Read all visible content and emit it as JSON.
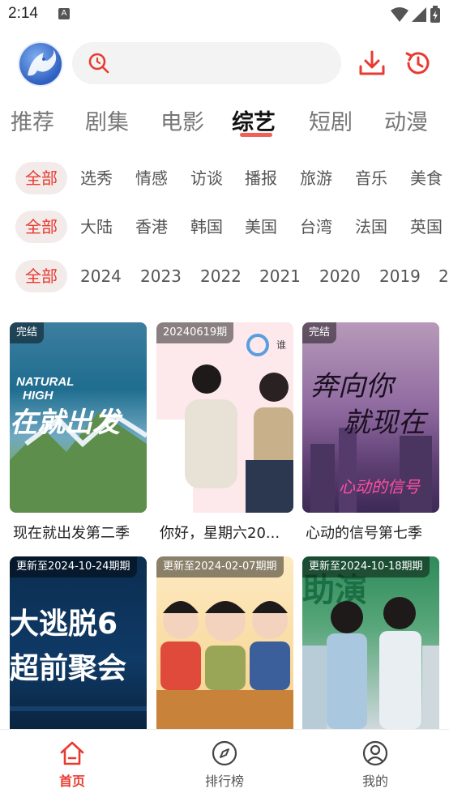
{
  "status": {
    "time": "2:14",
    "badge": "A"
  },
  "search": {
    "placeholder": ""
  },
  "category_tabs": [
    {
      "label": "推荐",
      "active": false
    },
    {
      "label": "剧集",
      "active": false
    },
    {
      "label": "电影",
      "active": false
    },
    {
      "label": "综艺",
      "active": true
    },
    {
      "label": "短剧",
      "active": false
    },
    {
      "label": "动漫",
      "active": false
    }
  ],
  "filters": {
    "type": [
      "全部",
      "选秀",
      "情感",
      "访谈",
      "播报",
      "旅游",
      "音乐",
      "美食"
    ],
    "region": [
      "全部",
      "大陆",
      "香港",
      "韩国",
      "美国",
      "台湾",
      "法国",
      "英国"
    ],
    "year": [
      "全部",
      "2024",
      "2023",
      "2022",
      "2021",
      "2020",
      "2019",
      "2"
    ]
  },
  "cards": [
    {
      "badge": "完结",
      "title": "现在就出发第二季",
      "poster_text": "NATURAL HIGH · 在就出发"
    },
    {
      "badge": "20240619期",
      "title": "你好，星期六20...",
      "poster_text": "谁"
    },
    {
      "badge": "完结",
      "title": "心动的信号第七季",
      "poster_text": "奔向你 就现在"
    },
    {
      "badge": "更新至2024-10-24期期",
      "title": "",
      "poster_text": "大逃脱6 超前聚会"
    },
    {
      "badge": "更新至2024-02-07期期",
      "title": "",
      "poster_text": ""
    },
    {
      "badge": "更新至2024-10-18期期",
      "title": "",
      "poster_text": "助演"
    }
  ],
  "bottom_nav": [
    {
      "label": "首页",
      "icon": "home-icon",
      "active": true
    },
    {
      "label": "排行榜",
      "icon": "compass-icon",
      "active": false
    },
    {
      "label": "我的",
      "icon": "profile-icon",
      "active": false
    }
  ],
  "colors": {
    "accent": "#e83a30",
    "chip_bg": "#f2ebea"
  }
}
